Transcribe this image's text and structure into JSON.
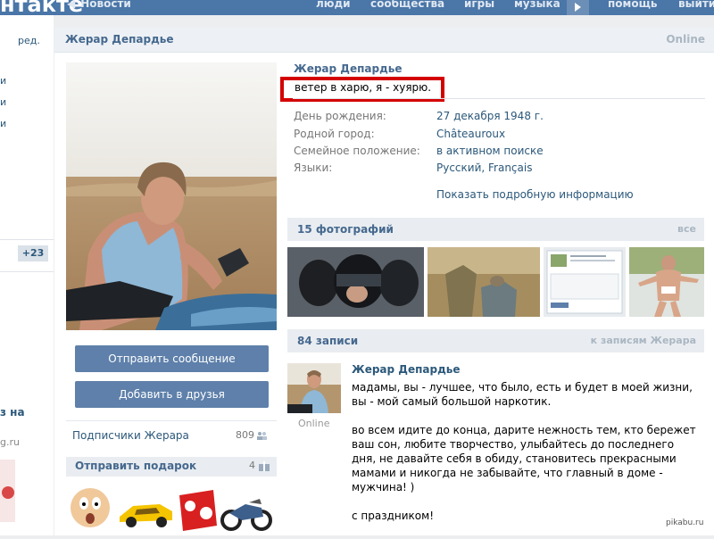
{
  "topbar": {
    "logo": "нтакте",
    "news": "Новости",
    "nav": [
      "люди",
      "сообщества",
      "игры",
      "музыка",
      "помощь",
      "выйти"
    ]
  },
  "leftnav": {
    "edit": "ред.",
    "items": [
      "и",
      "и",
      "и"
    ],
    "badge": "+23",
    "promo_title": "з на",
    "promo_site": "g.ru"
  },
  "header": {
    "name": "Жерар Депардье",
    "status": "Online"
  },
  "actions": {
    "send_message": "Отправить сообщение",
    "add_friend": "Добавить в друзья"
  },
  "subscribers": {
    "label": "Подписчики Жерара",
    "count": "809"
  },
  "gifts": {
    "title": "Отправить подарок",
    "count": "4"
  },
  "profile": {
    "name": "Жерар Депардье",
    "status_text": "ветер в харю, я - хуярю.",
    "fields": [
      {
        "label": "День рождения:",
        "value": "27 декабря 1948 г."
      },
      {
        "label": "Родной город:",
        "value": "Châteauroux"
      },
      {
        "label": "Семейное положение:",
        "value": "в активном поиске"
      },
      {
        "label": "Языки:",
        "value": "Русский, Français"
      }
    ],
    "more_info": "Показать подробную информацию"
  },
  "photos": {
    "title": "15 фотографий",
    "all": "все"
  },
  "posts": {
    "title": "84 записи",
    "link": "к записям Жерара",
    "author": "Жерар Депардье",
    "online": "Online",
    "text": "мадамы, вы - лучшее, что было, есть и будет в моей жизни,\nвы - мой самый большой наркотик.\n\nво всем идите до конца, дарите нежность тем, кто бережет\nваш сон, любите творчество, улыбайтесь до последнего\nдня, не давайте себя в обиду, становитесь прекрасными\nмамами и никогда не забывайте, что главный в доме -\nмужчина! )\n\nс праздником!"
  },
  "watermark": "pikabu.ru",
  "colors": {
    "topbar": "#4a76a8",
    "link": "#2b587a",
    "button": "#5e80aa",
    "status_box": "#d40000"
  }
}
